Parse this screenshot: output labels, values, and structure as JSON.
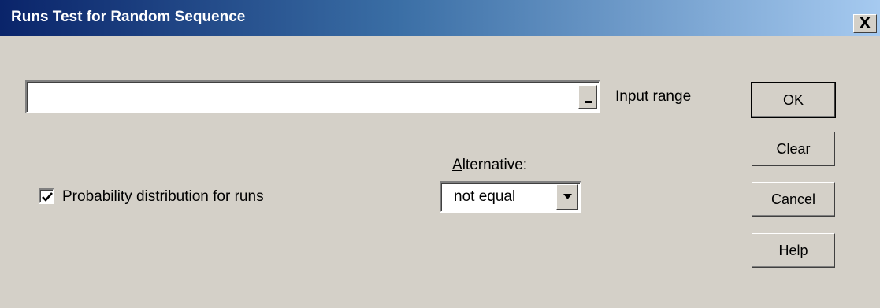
{
  "window": {
    "title": "Runs Test for Random Sequence",
    "close_glyph": "X"
  },
  "input_range": {
    "value": "",
    "label": "Input range",
    "label_accel": "I",
    "label_rest": "nput range",
    "button_icon": "collapse-dialog-icon"
  },
  "checkbox": {
    "label": "Probability distribution for runs",
    "checked": true
  },
  "alternative": {
    "label": "Alternative:",
    "label_accel": "A",
    "label_rest": "lternative:",
    "selected": "not equal"
  },
  "buttons": {
    "ok": "OK",
    "clear": "Clear",
    "cancel": "Cancel",
    "help": "Help"
  }
}
